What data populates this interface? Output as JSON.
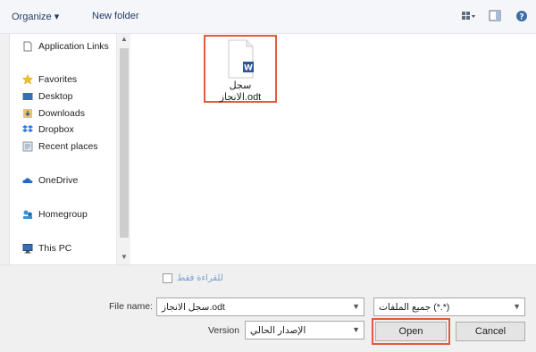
{
  "toolbar": {
    "organize_label": "Organize ▾",
    "new_folder_label": "New folder",
    "view_icon": "grid-view-icon",
    "pane_icon": "preview-pane-icon",
    "help_icon": "help-icon"
  },
  "nav": {
    "items": [
      {
        "label": "Application Links",
        "icon": "document-icon"
      },
      {
        "label": "Favorites",
        "icon": "star-icon"
      },
      {
        "label": "Desktop",
        "icon": "desktop-icon"
      },
      {
        "label": "Downloads",
        "icon": "downloads-icon"
      },
      {
        "label": "Dropbox",
        "icon": "dropbox-icon"
      },
      {
        "label": "Recent places",
        "icon": "recent-places-icon"
      },
      {
        "label": "OneDrive",
        "icon": "cloud-icon"
      },
      {
        "label": "Homegroup",
        "icon": "homegroup-icon"
      },
      {
        "label": "This PC",
        "icon": "pc-icon"
      }
    ]
  },
  "file": {
    "name_line1": "سجل",
    "name_line2": "الانجاز.odt",
    "icon": "word-document-icon"
  },
  "readonly_label": "للقراءة فقط",
  "filename": {
    "label": "File name:",
    "value": "سجل الانجاز.odt"
  },
  "filetype": {
    "value": "جميع الملفات (*.*)"
  },
  "version": {
    "label": "Version",
    "value": "الإصدار الحالي"
  },
  "buttons": {
    "open": "Open",
    "cancel": "Cancel"
  },
  "colors": {
    "highlight": "#e05a3c",
    "accent": "#1e3a5f"
  }
}
